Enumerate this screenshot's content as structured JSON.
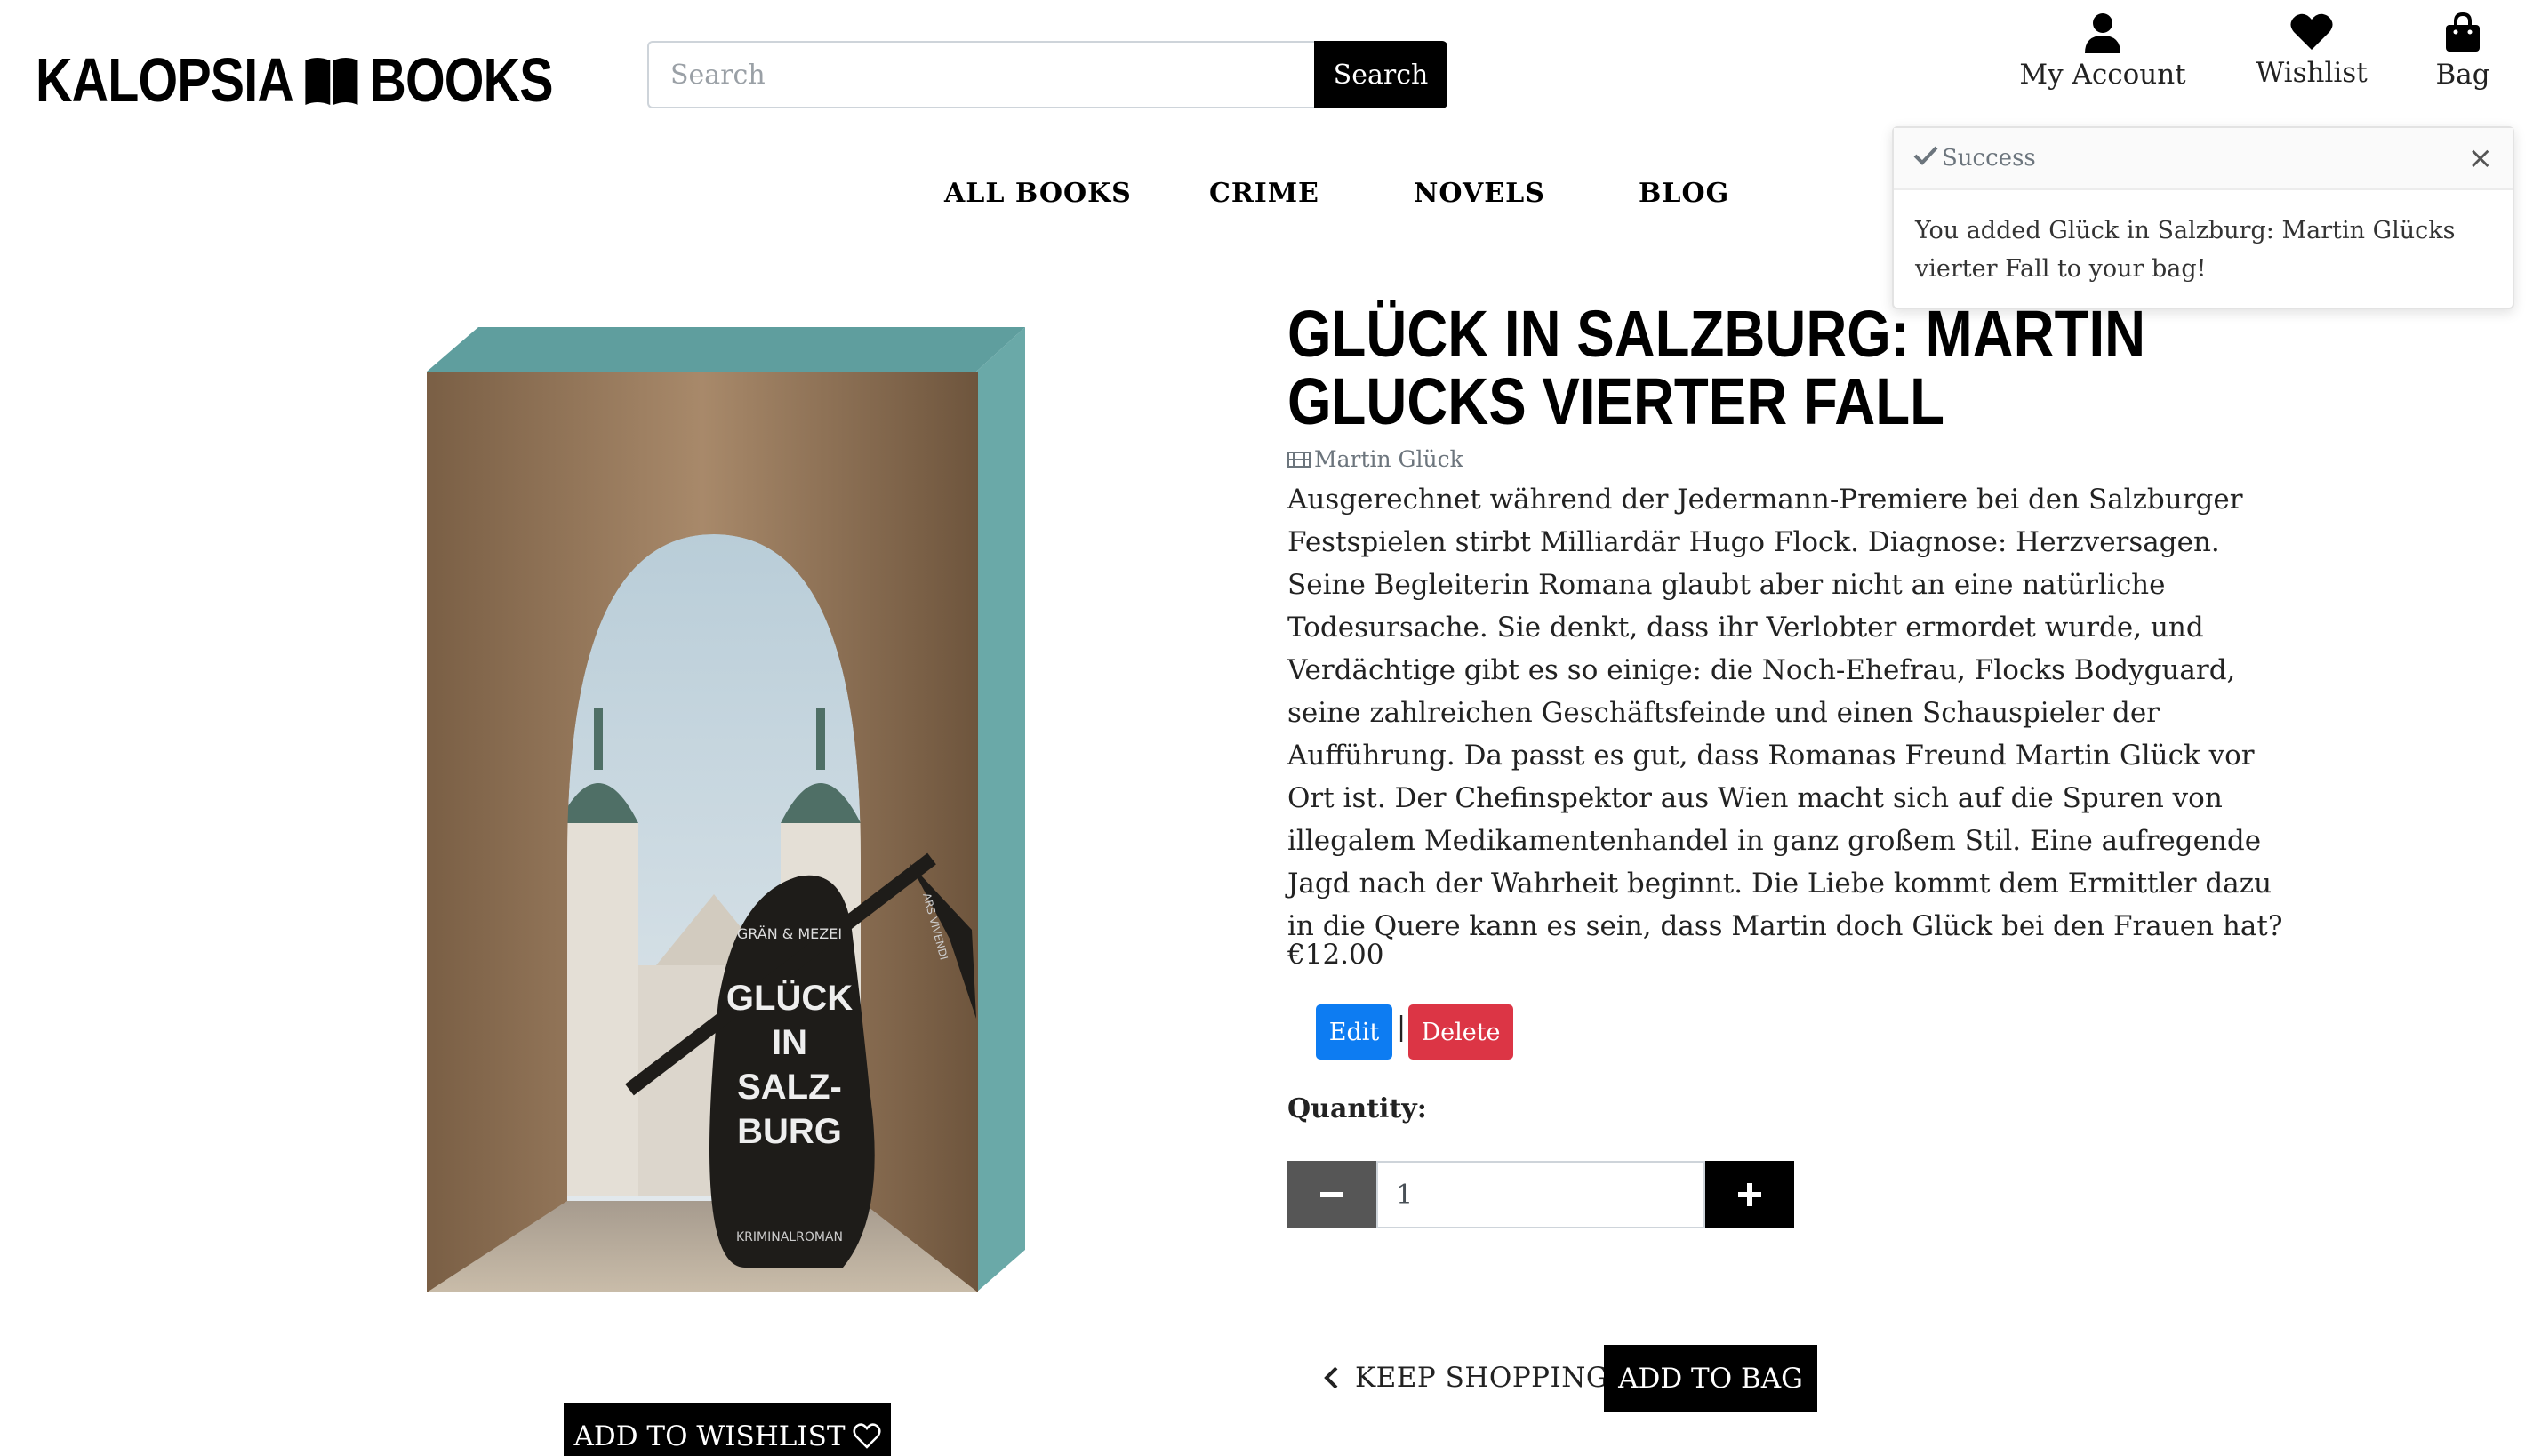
{
  "brand": {
    "name_left": "KALOPSIA",
    "name_right": "BOOKS"
  },
  "search": {
    "placeholder": "Search",
    "button_label": "Search"
  },
  "header_links": {
    "account": "My Account",
    "wishlist": "Wishlist",
    "bag": "Bag"
  },
  "nav": [
    "ALL BOOKS",
    "CRIME",
    "NOVELS",
    "BLOG"
  ],
  "toast": {
    "title": "Success",
    "close": "×",
    "message": "You added Glück in Salzburg: Martin Glücks vierter Fall to your bag!"
  },
  "book_cover": {
    "authors": "GRÄN & MEZEI",
    "title_lines": [
      "GLÜCK",
      "IN",
      "SALZ-",
      "BURG"
    ],
    "genre": "KRIMINALROMAN",
    "spine_text": "ARS VIVENDI",
    "spine_color": "#6aa9a8"
  },
  "product": {
    "title": "GLÜCK IN SALZBURG: MARTIN GLUCKS VIERTER FALL",
    "author": "Martin Glück",
    "description": "Ausgerechnet während der Jedermann-Premiere bei den Salzburger Festspielen stirbt Milliardär Hugo Flock. Diagnose: Herzversagen. Seine Begleiterin Romana glaubt aber nicht an eine natürliche Todesursache. Sie denkt, dass ihr Verlobter ermordet wurde, und Verdächtige gibt es so einige: die Noch-Ehefrau, Flocks Bodyguard, seine zahlreichen Geschäftsfeinde und einen Schauspieler der Aufführung. Da passt es gut, dass Romanas Freund Martin Glück vor Ort ist. Der Chefinspektor aus Wien macht sich auf die Spuren von illegalem Medikamentenhandel in ganz großem Stil. Eine aufregende Jagd nach der Wahrheit beginnt. Die Liebe kommt dem Ermittler dazu in die Quere kann es sein, dass Martin doch Glück bei den Frauen hat?",
    "price": "€12.00",
    "edit_label": "Edit",
    "separator": "|",
    "delete_label": "Delete",
    "quantity_label": "Quantity:",
    "quantity_value": "1",
    "keep_shopping_label": "KEEP SHOPPING",
    "add_to_bag_label": "ADD TO BAG",
    "add_to_wishlist_label": "ADD TO WISHLIST"
  },
  "colors": {
    "edit": "#0d7cf2",
    "delete": "#dc3545",
    "qty_minus": "#565656",
    "primary_dark": "#000000"
  }
}
